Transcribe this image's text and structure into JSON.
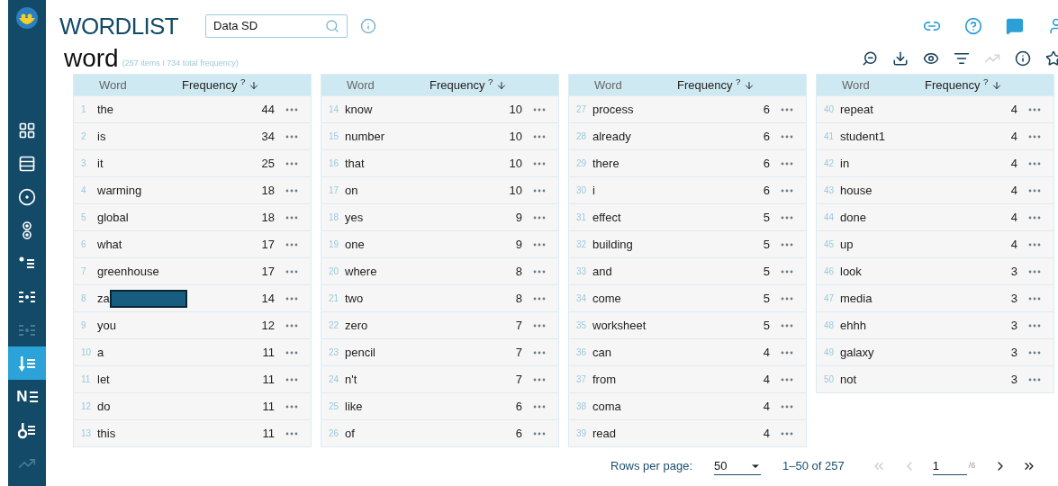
{
  "sidebar": {
    "items": [
      {
        "kind": "dashboard",
        "selected": false,
        "disabled": false
      },
      {
        "kind": "list",
        "selected": false,
        "disabled": false
      },
      {
        "kind": "target",
        "selected": false,
        "disabled": false
      },
      {
        "kind": "pair",
        "selected": false,
        "disabled": false
      },
      {
        "kind": "bullets",
        "selected": false,
        "disabled": false
      },
      {
        "kind": "cluster",
        "selected": false,
        "disabled": false
      },
      {
        "kind": "cluster",
        "selected": false,
        "disabled": true
      },
      {
        "kind": "sort",
        "selected": true,
        "disabled": false
      },
      {
        "kind": "letter",
        "label": "N",
        "selected": false,
        "disabled": false
      },
      {
        "kind": "keyword",
        "selected": false,
        "disabled": false
      },
      {
        "kind": "trend",
        "selected": false,
        "disabled": true
      }
    ]
  },
  "header": {
    "title": "WORDLIST",
    "search": {
      "value": "Data SD"
    },
    "actions": [
      {
        "kind": "link"
      },
      {
        "kind": "help"
      },
      {
        "kind": "feedback"
      },
      {
        "kind": "user"
      }
    ]
  },
  "subheader": {
    "title": "word",
    "summary": "(257 items I 734 total frequency)",
    "tools": [
      {
        "kind": "reset-zoom",
        "disabled": false
      },
      {
        "kind": "download",
        "disabled": false
      },
      {
        "kind": "eye",
        "disabled": false
      },
      {
        "kind": "filter",
        "disabled": false
      },
      {
        "kind": "trend",
        "disabled": true
      },
      {
        "kind": "info",
        "disabled": false
      },
      {
        "kind": "star",
        "disabled": false
      }
    ]
  },
  "tables": [
    {
      "columns": [
        "Word",
        "Frequency"
      ],
      "help_mark": "?",
      "rows": [
        {
          "rank": "1",
          "word": "the",
          "frequency": "44",
          "redacted": false
        },
        {
          "rank": "2",
          "word": "is",
          "frequency": "34",
          "redacted": false
        },
        {
          "rank": "3",
          "word": "it",
          "frequency": "25",
          "redacted": false
        },
        {
          "rank": "4",
          "word": "warming",
          "frequency": "18",
          "redacted": false
        },
        {
          "rank": "5",
          "word": "global",
          "frequency": "18",
          "redacted": false
        },
        {
          "rank": "6",
          "word": "what",
          "frequency": "17",
          "redacted": false
        },
        {
          "rank": "7",
          "word": "greenhouse",
          "frequency": "17",
          "redacted": false
        },
        {
          "rank": "8",
          "word": "za",
          "frequency": "14",
          "redacted": true
        },
        {
          "rank": "9",
          "word": "you",
          "frequency": "12",
          "redacted": false
        },
        {
          "rank": "10",
          "word": "a",
          "frequency": "11",
          "redacted": false
        },
        {
          "rank": "11",
          "word": "let",
          "frequency": "11",
          "redacted": false
        },
        {
          "rank": "12",
          "word": "do",
          "frequency": "11",
          "redacted": false
        },
        {
          "rank": "13",
          "word": "this",
          "frequency": "11",
          "redacted": false
        }
      ]
    },
    {
      "columns": [
        "Word",
        "Frequency"
      ],
      "help_mark": "?",
      "rows": [
        {
          "rank": "14",
          "word": "know",
          "frequency": "10",
          "redacted": false
        },
        {
          "rank": "15",
          "word": "number",
          "frequency": "10",
          "redacted": false
        },
        {
          "rank": "16",
          "word": "that",
          "frequency": "10",
          "redacted": false
        },
        {
          "rank": "17",
          "word": "on",
          "frequency": "10",
          "redacted": false
        },
        {
          "rank": "18",
          "word": "yes",
          "frequency": "9",
          "redacted": false
        },
        {
          "rank": "19",
          "word": "one",
          "frequency": "9",
          "redacted": false
        },
        {
          "rank": "20",
          "word": "where",
          "frequency": "8",
          "redacted": false
        },
        {
          "rank": "21",
          "word": "two",
          "frequency": "8",
          "redacted": false
        },
        {
          "rank": "22",
          "word": "zero",
          "frequency": "7",
          "redacted": false
        },
        {
          "rank": "23",
          "word": "pencil",
          "frequency": "7",
          "redacted": false
        },
        {
          "rank": "24",
          "word": "n't",
          "frequency": "7",
          "redacted": false
        },
        {
          "rank": "25",
          "word": "like",
          "frequency": "6",
          "redacted": false
        },
        {
          "rank": "26",
          "word": "of",
          "frequency": "6",
          "redacted": false
        }
      ]
    },
    {
      "columns": [
        "Word",
        "Frequency"
      ],
      "help_mark": "?",
      "rows": [
        {
          "rank": "27",
          "word": "process",
          "frequency": "6",
          "redacted": false
        },
        {
          "rank": "28",
          "word": "already",
          "frequency": "6",
          "redacted": false
        },
        {
          "rank": "29",
          "word": "there",
          "frequency": "6",
          "redacted": false
        },
        {
          "rank": "30",
          "word": "i",
          "frequency": "6",
          "redacted": false
        },
        {
          "rank": "31",
          "word": "effect",
          "frequency": "5",
          "redacted": false
        },
        {
          "rank": "32",
          "word": "building",
          "frequency": "5",
          "redacted": false
        },
        {
          "rank": "33",
          "word": "and",
          "frequency": "5",
          "redacted": false
        },
        {
          "rank": "34",
          "word": "come",
          "frequency": "5",
          "redacted": false
        },
        {
          "rank": "35",
          "word": "worksheet",
          "frequency": "5",
          "redacted": false
        },
        {
          "rank": "36",
          "word": "can",
          "frequency": "4",
          "redacted": false
        },
        {
          "rank": "37",
          "word": "from",
          "frequency": "4",
          "redacted": false
        },
        {
          "rank": "38",
          "word": "coma",
          "frequency": "4",
          "redacted": false
        },
        {
          "rank": "39",
          "word": "read",
          "frequency": "4",
          "redacted": false
        }
      ]
    },
    {
      "columns": [
        "Word",
        "Frequency"
      ],
      "help_mark": "?",
      "rows": [
        {
          "rank": "40",
          "word": "repeat",
          "frequency": "4",
          "redacted": false
        },
        {
          "rank": "41",
          "word": "student1",
          "frequency": "4",
          "redacted": false
        },
        {
          "rank": "42",
          "word": "in",
          "frequency": "4",
          "redacted": false
        },
        {
          "rank": "43",
          "word": "house",
          "frequency": "4",
          "redacted": false
        },
        {
          "rank": "44",
          "word": "done",
          "frequency": "4",
          "redacted": false
        },
        {
          "rank": "45",
          "word": "up",
          "frequency": "4",
          "redacted": false
        },
        {
          "rank": "46",
          "word": "look",
          "frequency": "3",
          "redacted": false
        },
        {
          "rank": "47",
          "word": "media",
          "frequency": "3",
          "redacted": false
        },
        {
          "rank": "48",
          "word": "ehhh",
          "frequency": "3",
          "redacted": false
        },
        {
          "rank": "49",
          "word": "galaxy",
          "frequency": "3",
          "redacted": false
        },
        {
          "rank": "50",
          "word": "not",
          "frequency": "3",
          "redacted": false
        }
      ]
    }
  ],
  "pagination": {
    "rows_per_page_label": "Rows per page:",
    "rows_per_page": "50",
    "range": "1–50 of 257",
    "page": "1",
    "page_total": "/6",
    "first_disabled": true,
    "prev_disabled": true,
    "next_disabled": false,
    "last_disabled": false
  }
}
